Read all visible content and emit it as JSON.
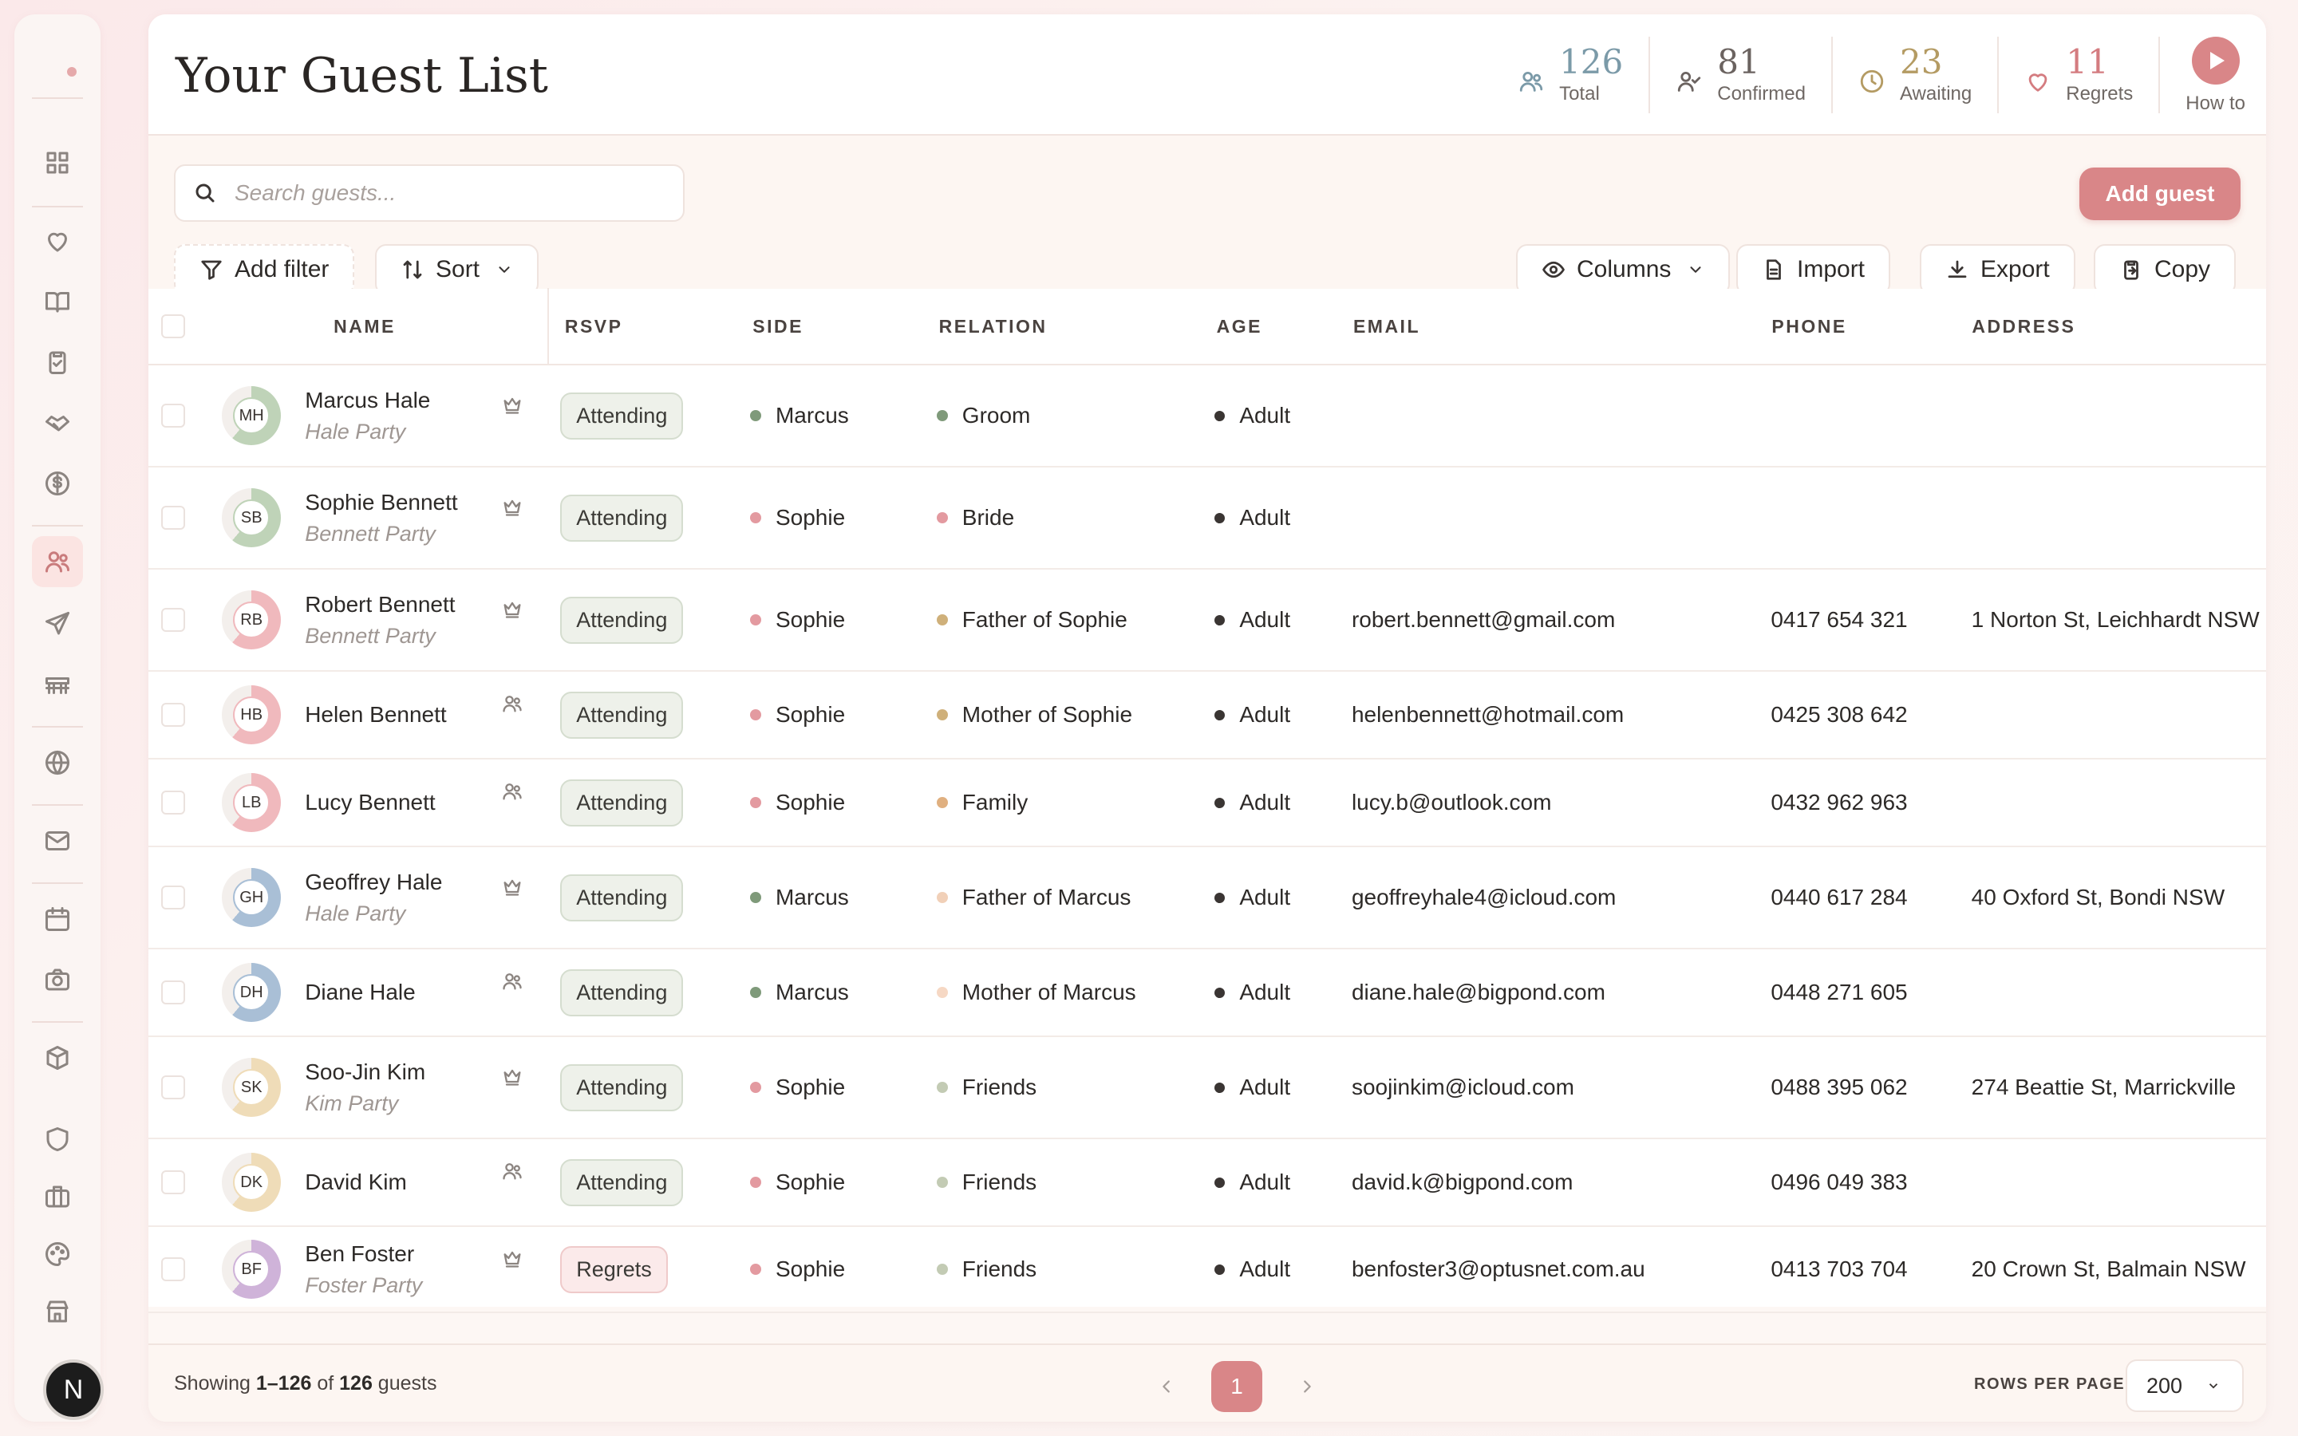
{
  "header": {
    "title": "Your Guest List",
    "stats": [
      {
        "value": "126",
        "label": "Total",
        "color": "#7b9aa8",
        "icon": "users-icon"
      },
      {
        "value": "81",
        "label": "Confirmed",
        "color": "#6b6360",
        "icon": "user-check-icon"
      },
      {
        "value": "23",
        "label": "Awaiting",
        "color": "#b49b63",
        "icon": "clock-icon"
      },
      {
        "value": "11",
        "label": "Regrets",
        "color": "#d47c80",
        "icon": "heart-icon"
      }
    ],
    "howto_label": "How to"
  },
  "toolbar": {
    "search_placeholder": "Search guests...",
    "add_guest": "Add guest",
    "add_filter": "Add filter",
    "sort": "Sort",
    "columns": "Columns",
    "import": "Import",
    "export": "Export",
    "copy": "Copy"
  },
  "table": {
    "headers": [
      "NAME",
      "RSVP",
      "SIDE",
      "RELATION",
      "AGE",
      "EMAIL",
      "PHONE",
      "ADDRESS"
    ],
    "rows": [
      {
        "initials": "MH",
        "name": "Marcus Hale",
        "party": "Hale Party",
        "role": "crown",
        "rsvp": "Attending",
        "side": "Marcus",
        "side_color": "#7f9a7a",
        "relation": "Groom",
        "rel_color": "#7f9a7a",
        "age": "Adult",
        "email": "",
        "phone": "",
        "address": "",
        "av_color": "#bfd3b8"
      },
      {
        "initials": "SB",
        "name": "Sophie Bennett",
        "party": "Bennett Party",
        "role": "crown",
        "rsvp": "Attending",
        "side": "Sophie",
        "side_color": "#e39aa0",
        "relation": "Bride",
        "rel_color": "#e39aa0",
        "age": "Adult",
        "email": "",
        "phone": "",
        "address": "",
        "av_color": "#bfd3b8"
      },
      {
        "initials": "RB",
        "name": "Robert Bennett",
        "party": "Bennett Party",
        "role": "crown",
        "rsvp": "Attending",
        "side": "Sophie",
        "side_color": "#e39aa0",
        "relation": "Father of Sophie",
        "rel_color": "#cfb07a",
        "age": "Adult",
        "email": "robert.bennett@gmail.com",
        "phone": "0417 654 321",
        "address": "1 Norton St, Leichhardt NSW",
        "av_color": "#f0b9bd"
      },
      {
        "initials": "HB",
        "name": "Helen Bennett",
        "party": "",
        "role": "users",
        "rsvp": "Attending",
        "side": "Sophie",
        "side_color": "#e39aa0",
        "relation": "Mother of Sophie",
        "rel_color": "#cfb07a",
        "age": "Adult",
        "email": "helenbennett@hotmail.com",
        "phone": "0425 308 642",
        "address": "",
        "av_color": "#f0b9bd"
      },
      {
        "initials": "LB",
        "name": "Lucy Bennett",
        "party": "",
        "role": "users",
        "rsvp": "Attending",
        "side": "Sophie",
        "side_color": "#e39aa0",
        "relation": "Family",
        "rel_color": "#e0b080",
        "age": "Adult",
        "email": "lucy.b@outlook.com",
        "phone": "0432 962 963",
        "address": "",
        "av_color": "#f0b9bd"
      },
      {
        "initials": "GH",
        "name": "Geoffrey Hale",
        "party": "Hale Party",
        "role": "crown",
        "rsvp": "Attending",
        "side": "Marcus",
        "side_color": "#7f9a7a",
        "relation": "Father of Marcus",
        "rel_color": "#f1d0b8",
        "age": "Adult",
        "email": "geoffreyhale4@icloud.com",
        "phone": "0440 617 284",
        "address": "40 Oxford St, Bondi NSW",
        "av_color": "#a9bfd6"
      },
      {
        "initials": "DH",
        "name": "Diane Hale",
        "party": "",
        "role": "users",
        "rsvp": "Attending",
        "side": "Marcus",
        "side_color": "#7f9a7a",
        "relation": "Mother of Marcus",
        "rel_color": "#f6d8c4",
        "age": "Adult",
        "email": "diane.hale@bigpond.com",
        "phone": "0448 271 605",
        "address": "",
        "av_color": "#a9bfd6"
      },
      {
        "initials": "SK",
        "name": "Soo-Jin Kim",
        "party": "Kim Party",
        "role": "crown",
        "rsvp": "Attending",
        "side": "Sophie",
        "side_color": "#e39aa0",
        "relation": "Friends",
        "rel_color": "#c3cbb4",
        "age": "Adult",
        "email": "soojinkim@icloud.com",
        "phone": "0488 395 062",
        "address": "274 Beattie St, Marrickville",
        "av_color": "#efdcb8"
      },
      {
        "initials": "DK",
        "name": "David Kim",
        "party": "",
        "role": "users",
        "rsvp": "Attending",
        "side": "Sophie",
        "side_color": "#e39aa0",
        "relation": "Friends",
        "rel_color": "#c3cbb4",
        "age": "Adult",
        "email": "david.k@bigpond.com",
        "phone": "0496 049 383",
        "address": "",
        "av_color": "#efdcb8"
      },
      {
        "initials": "BF",
        "name": "Ben Foster",
        "party": "Foster Party",
        "role": "crown",
        "rsvp": "Regrets",
        "side": "Sophie",
        "side_color": "#e39aa0",
        "relation": "Friends",
        "rel_color": "#c3cbb4",
        "age": "Adult",
        "email": "benfoster3@optusnet.com.au",
        "phone": "0413 703 704",
        "address": "20 Crown St, Balmain NSW",
        "av_color": "#cfb3d9"
      }
    ]
  },
  "footer": {
    "showing_prefix": "Showing ",
    "showing_range": "1–126",
    "showing_of": " of ",
    "showing_total": "126",
    "showing_suffix": " guests",
    "page": "1",
    "rows_per_page_label": "ROWS PER PAGE",
    "rows_per_page": "200"
  },
  "user": {
    "initial": "N"
  }
}
